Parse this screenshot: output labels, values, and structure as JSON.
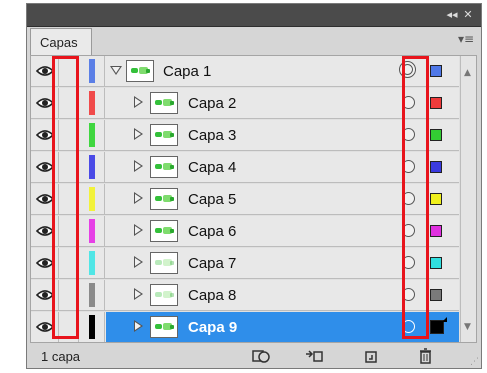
{
  "panel": {
    "tab_label": "Capas",
    "collapse_icon": "double-chevron-icon",
    "close_icon": "close-icon",
    "collapse_glyph": "◂◂",
    "close_glyph": "✕",
    "menu_glyph": "▾≡",
    "menu_icon": "panel-menu-icon"
  },
  "layers": [
    {
      "name": "Capa 1",
      "color": "#5b7fe6",
      "swatch": "#4f78e8",
      "expanded": true
    },
    {
      "name": "Capa 2",
      "color": "#f04a4a",
      "swatch": "#ee3a3a"
    },
    {
      "name": "Capa 3",
      "color": "#3fd63f",
      "swatch": "#33cc33"
    },
    {
      "name": "Capa 4",
      "color": "#4a4ae6",
      "swatch": "#3a3ae0"
    },
    {
      "name": "Capa 5",
      "color": "#f2f23a",
      "swatch": "#f0f01c"
    },
    {
      "name": "Capa 6",
      "color": "#e640e6",
      "swatch": "#e030e0"
    },
    {
      "name": "Capa 7",
      "color": "#50e6e6",
      "swatch": "#30e0e0"
    },
    {
      "name": "Capa 8",
      "color": "#8a8a8a",
      "swatch": "#7a7a7a"
    },
    {
      "name": "Capa 9",
      "color": "#000000",
      "swatch": "#000000",
      "selected": true
    }
  ],
  "status": {
    "layer_count": "1 capa",
    "buttons": [
      "make-clipping-mask-icon",
      "create-sublayer-icon",
      "create-new-layer-icon",
      "delete-layer-icon"
    ]
  },
  "highlight_color": "#e8141c",
  "selection_color": "#2f8eea"
}
